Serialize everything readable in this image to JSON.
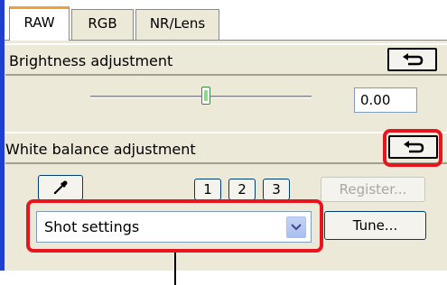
{
  "tabs": [
    {
      "label": "RAW",
      "active": true
    },
    {
      "label": "RGB",
      "active": false
    },
    {
      "label": "NR/Lens",
      "active": false
    }
  ],
  "brightness": {
    "title": "Brightness adjustment",
    "value": "0.00",
    "slider_fraction": 0.5
  },
  "white_balance": {
    "title": "White balance adjustment",
    "presets": [
      "1",
      "2",
      "3"
    ],
    "register_label": "Register...",
    "register_enabled": false,
    "selected": "Shot settings",
    "tune_label": "Tune..."
  },
  "colors": {
    "frame_blue": "#1f3fd0",
    "panel_bg": "#ece9d8",
    "highlight_red": "#e8141e",
    "active_tab_accent": "#f0a030"
  },
  "icons": {
    "undo": "undo-arrow-icon",
    "eyedropper": "eyedropper-icon",
    "dropdown": "chevron-down-icon"
  }
}
